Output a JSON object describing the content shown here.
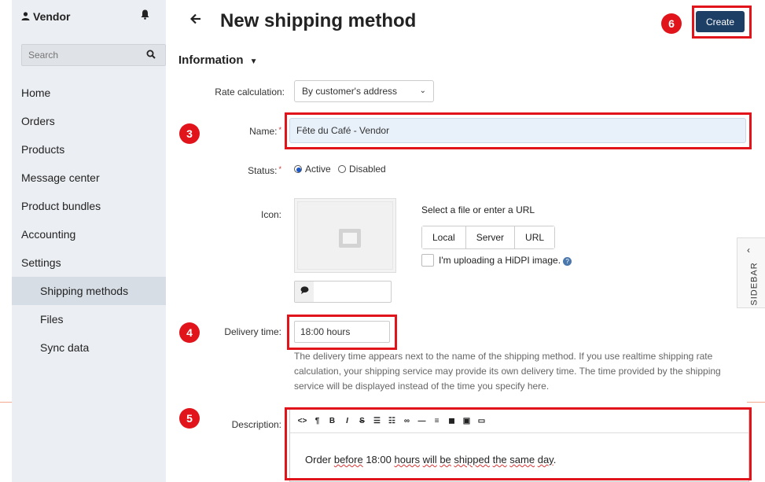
{
  "sidebar": {
    "vendor_label": "Vendor",
    "search_placeholder": "Search",
    "items": [
      {
        "label": "Home"
      },
      {
        "label": "Orders"
      },
      {
        "label": "Products"
      },
      {
        "label": "Message center"
      },
      {
        "label": "Product bundles"
      },
      {
        "label": "Accounting"
      },
      {
        "label": "Settings"
      },
      {
        "label": "Shipping methods"
      },
      {
        "label": "Files"
      },
      {
        "label": "Sync data"
      }
    ]
  },
  "header": {
    "title": "New shipping method",
    "create_label": "Create"
  },
  "section": {
    "title": "Information"
  },
  "form": {
    "rate_label": "Rate calculation:",
    "rate_value": "By customer's address",
    "name_label": "Name:",
    "name_value": "Fête du Café - Vendor",
    "status_label": "Status:",
    "status_active": "Active",
    "status_disabled": "Disabled",
    "status_selected": "Active",
    "icon_label": "Icon:",
    "file_caption": "Select a file or enter a URL",
    "file_buttons": [
      "Local",
      "Server",
      "URL"
    ],
    "hidpi_label": "I'm uploading a HiDPI image.",
    "delivery_label": "Delivery time:",
    "delivery_value": "18:00 hours",
    "delivery_help": "The delivery time appears next to the name of the shipping method. If you use realtime shipping rate calculation, your shipping service may provide its own delivery time. The time provided by the shipping service will be displayed instead of the time you specify here.",
    "description_label": "Description:",
    "description_parts": [
      "Order ",
      "before",
      " 18:00 ",
      "hours",
      " ",
      "will",
      " ",
      "be",
      " ",
      "shipped",
      " ",
      "the",
      " ",
      "same",
      " ",
      "day",
      "."
    ]
  },
  "sidebar_tab": {
    "label": "SIDEBAR"
  },
  "annotations": {
    "badge3": "3",
    "badge4": "4",
    "badge5": "5",
    "badge6": "6"
  },
  "colors": {
    "accent": "#1d3f66",
    "annotation_red": "#e1131b",
    "sidebar_bg": "#ebeef2"
  }
}
